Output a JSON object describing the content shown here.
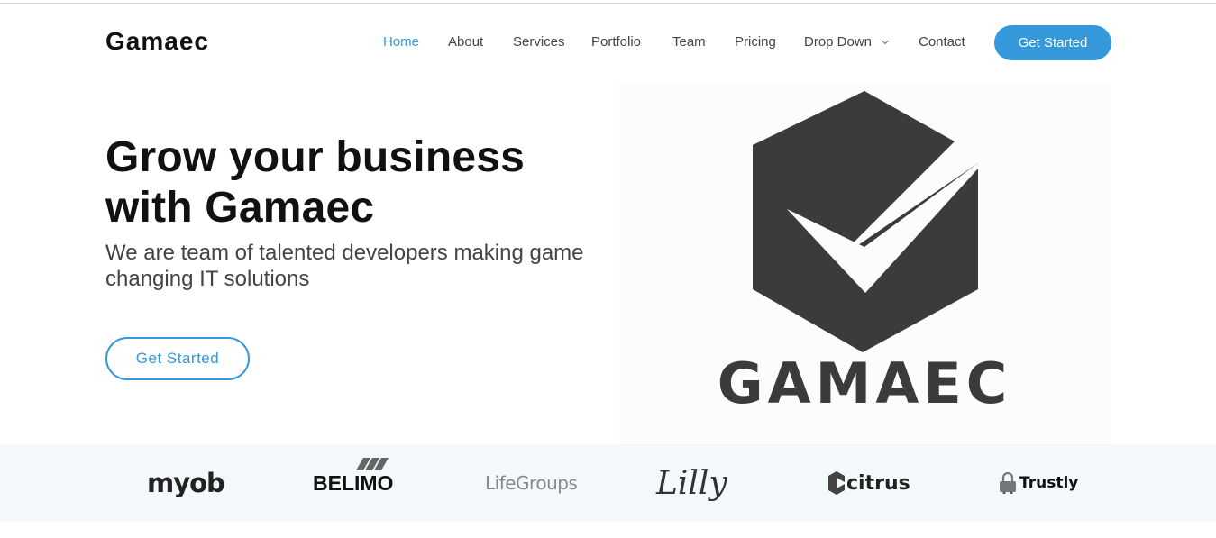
{
  "brand": {
    "name": "Gamaec"
  },
  "nav": {
    "items": [
      {
        "label": "Home"
      },
      {
        "label": "About"
      },
      {
        "label": "Services"
      },
      {
        "label": "Portfolio"
      },
      {
        "label": "Team"
      },
      {
        "label": "Pricing"
      },
      {
        "label": "Drop Down"
      },
      {
        "label": "Contact"
      }
    ],
    "cta_label": "Get Started"
  },
  "hero": {
    "title": "Grow your business with Gamaec",
    "subtitle": "We are team of talented developers making game changing IT solutions",
    "button_label": "Get Started",
    "logo_text": "GAMAEC"
  },
  "clients": [
    {
      "name": "myob"
    },
    {
      "name": "BELIMO"
    },
    {
      "name": "LifeGroups"
    },
    {
      "name": "Lilly"
    },
    {
      "name": "citrus"
    },
    {
      "name": "Trustly"
    }
  ],
  "colors": {
    "accent": "#3498db",
    "logo_gray": "#3b3b3d",
    "strip_bg": "#f3f8fb"
  },
  "icons": {
    "dropdown": "chevron-down-icon"
  }
}
